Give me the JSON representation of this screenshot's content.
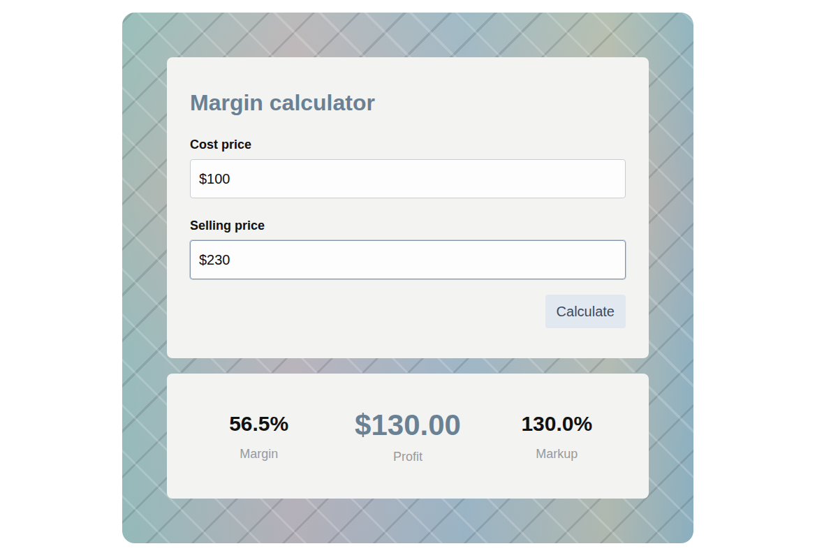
{
  "title": "Margin calculator",
  "fields": [
    {
      "label": "Cost price",
      "value": "$100",
      "focused": false
    },
    {
      "label": "Selling price",
      "value": "$230",
      "focused": true
    }
  ],
  "button": "Calculate",
  "results": [
    {
      "value": "56.5%",
      "label": "Margin",
      "kind": "secondary"
    },
    {
      "value": "$130.00",
      "label": "Profit",
      "kind": "primary"
    },
    {
      "value": "130.0%",
      "label": "Markup",
      "kind": "secondary"
    }
  ]
}
